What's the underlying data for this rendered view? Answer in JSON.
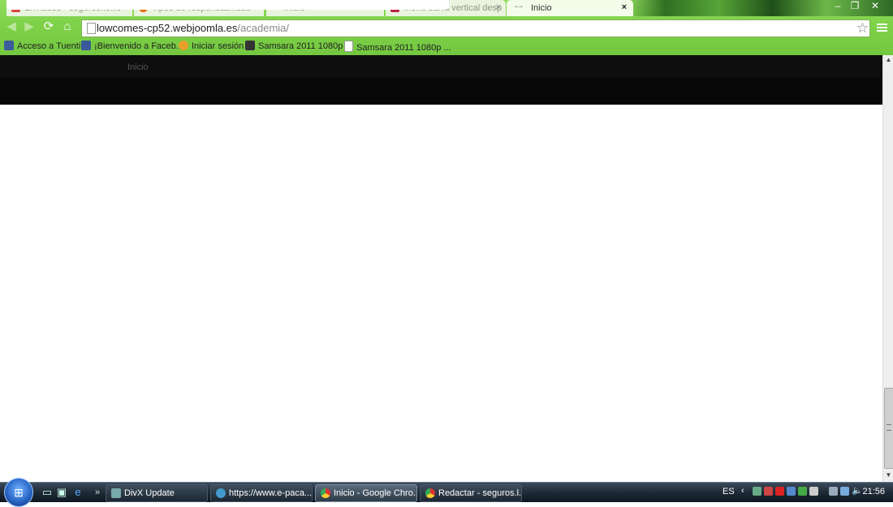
{
  "browser": {
    "tabs": [
      {
        "label": "Enviados - seguros.lowc",
        "favicon_color": "#d44"
      },
      {
        "label": "Tipos de responsabilidad",
        "favicon_color": "#e60"
      },
      {
        "label": "Inicio",
        "favicon_color": "#999"
      },
      {
        "label": "Menu barra vertical desp",
        "favicon_color": "#b24"
      },
      {
        "label": "Inicio",
        "favicon_color": "#777",
        "active": true
      }
    ],
    "tab_close_glyph": "×",
    "window_buttons": {
      "minimize": "–",
      "maximize": "❐",
      "close": "✕"
    },
    "url": {
      "host": "lowcomes-cp52.webjoomla.es",
      "path": "/academia/"
    },
    "bookmarks": [
      {
        "label": "Acceso a Tuenti",
        "icon": "tuenti-icon",
        "color": "#3b5d9c"
      },
      {
        "label": "¡Bienvenido a Faceb...",
        "icon": "facebook-icon",
        "color": "#3b5998"
      },
      {
        "label": "Iniciar sesión",
        "icon": "windows-live-icon",
        "color": "#e8a02a"
      },
      {
        "label": "Samsara 2011 1080p ...",
        "icon": "film-icon",
        "color": "#333"
      },
      {
        "label": "Samsara 2011 1080p ...",
        "icon": "page-icon",
        "color": "#fff"
      }
    ]
  },
  "site": {
    "nav_items": [
      {
        "label": "Inicio"
      }
    ]
  },
  "taskbar": {
    "tasks": [
      {
        "label": "DivX Update",
        "icon_color": "#7aa"
      },
      {
        "label": "https://www.e-paca...",
        "icon_color": "#49c"
      },
      {
        "label": "Inicio - Google Chro...",
        "icon_color": "#d93"
      },
      {
        "label": "Redactar - seguros.l...",
        "icon_color": "#d93"
      }
    ],
    "language": "ES",
    "clock": "21:56"
  },
  "colors": {
    "chrome_frame": "#7fd24a",
    "site_nav": "#0e0e0e"
  }
}
